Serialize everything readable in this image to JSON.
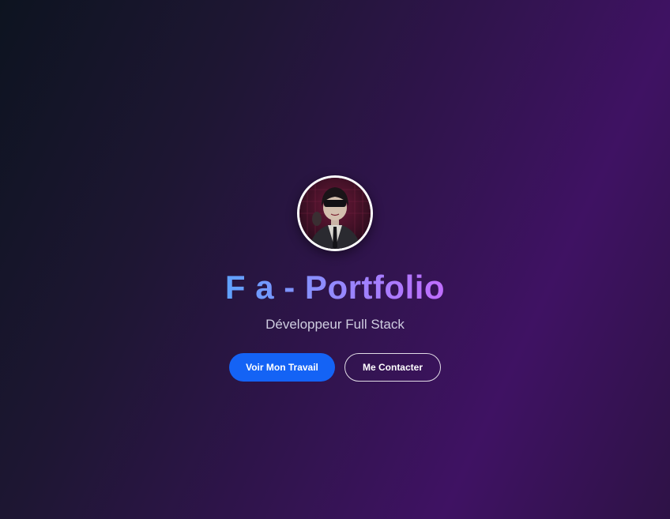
{
  "hero": {
    "avatar_icon": "profile-avatar",
    "title": "F a - Portfolio",
    "subtitle": "Développeur Full Stack",
    "primary_button": "Voir Mon Travail",
    "secondary_button": "Me Contacter"
  },
  "colors": {
    "primary": "#1463f5",
    "title_gradient_start": "#5fa2ff",
    "title_gradient_end": "#c06dff"
  }
}
